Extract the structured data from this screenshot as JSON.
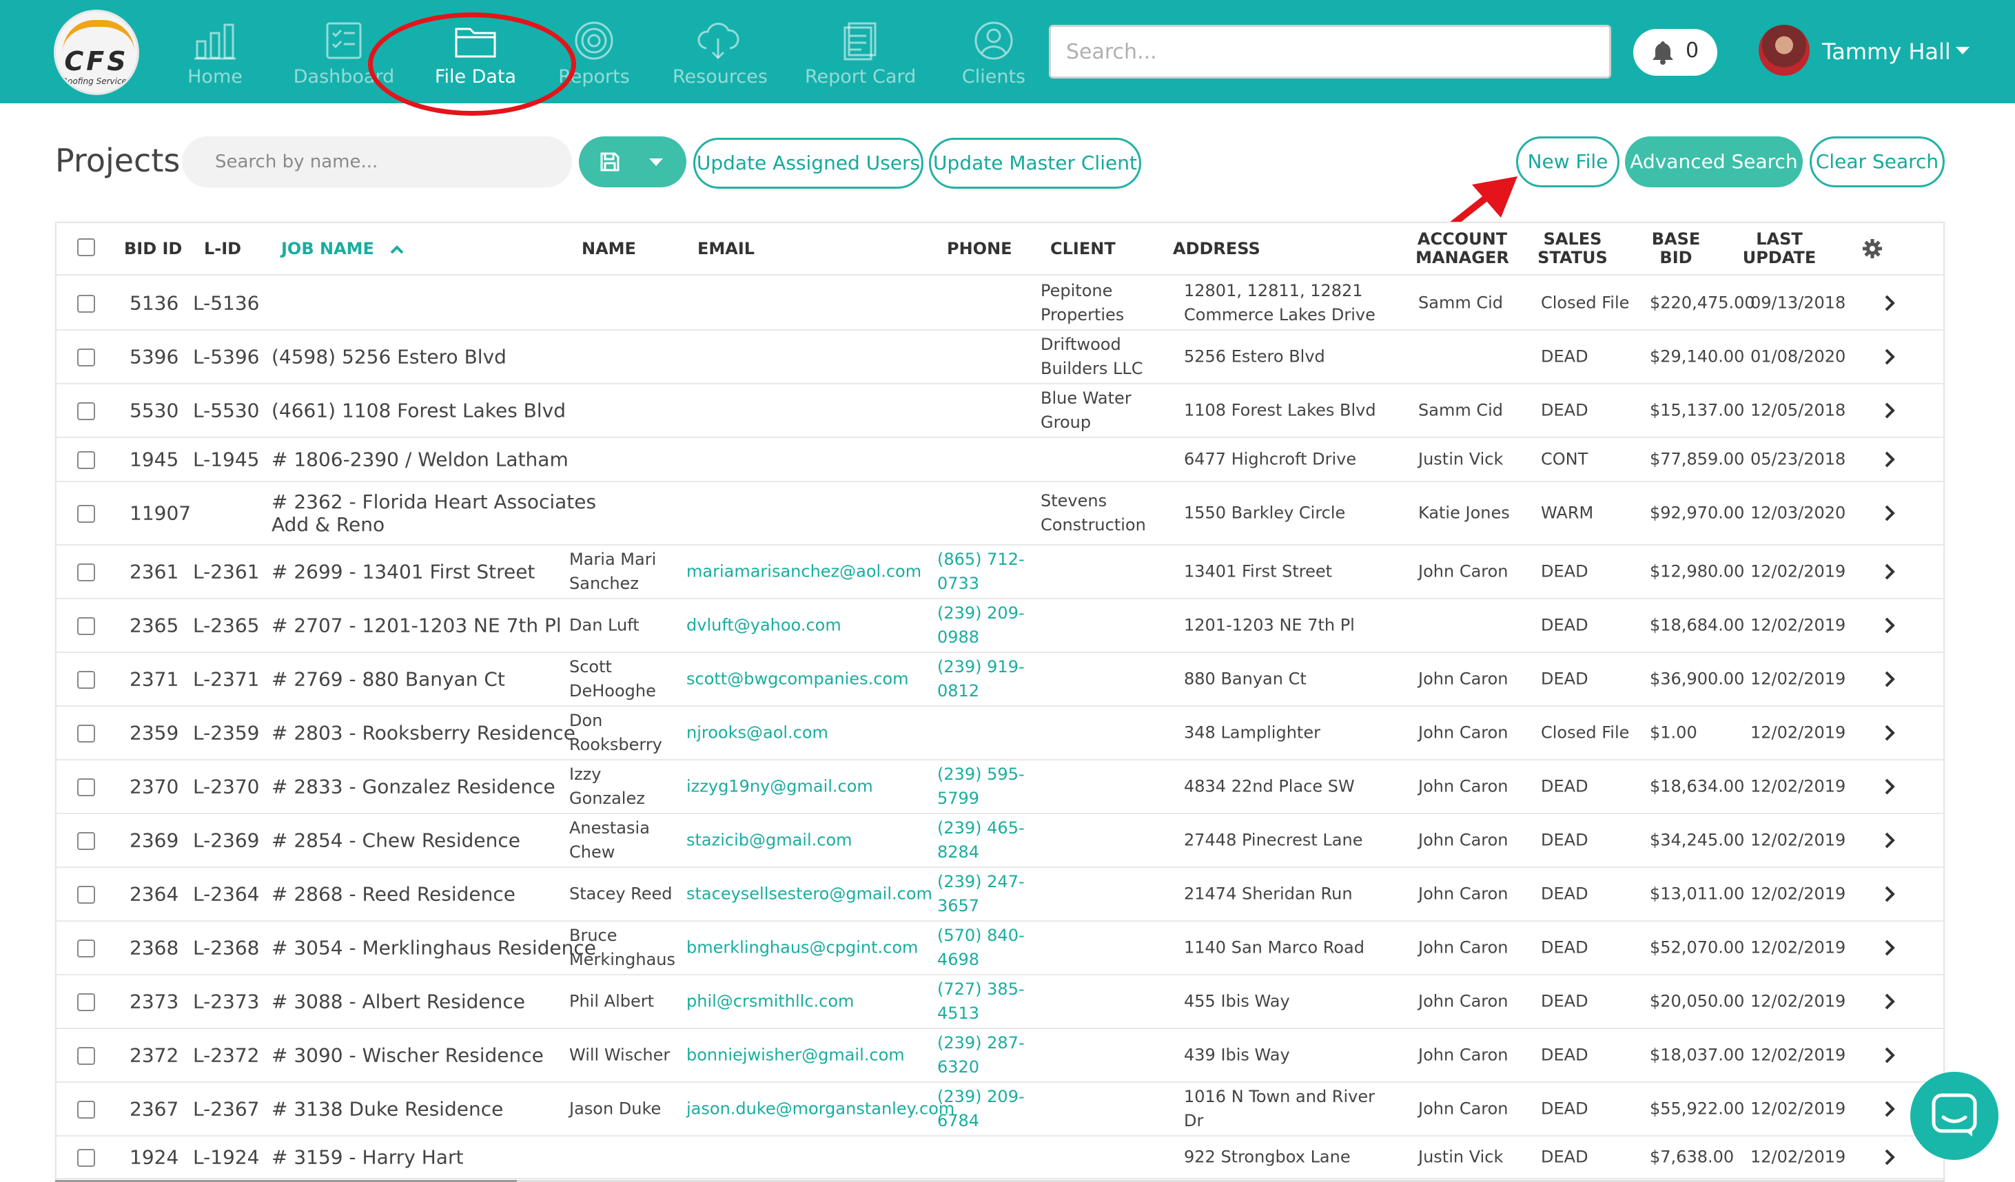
{
  "brand": {
    "logo_letters": "CFS",
    "logo_tagline": "Roofing Services"
  },
  "nav": {
    "items": [
      {
        "label": "Home",
        "icon": "bar-chart-icon"
      },
      {
        "label": "Dashboard",
        "icon": "clipboard-check-icon"
      },
      {
        "label": "File Data",
        "icon": "folder-icon",
        "active": true
      },
      {
        "label": "Reports",
        "icon": "target-icon"
      },
      {
        "label": "Resources",
        "icon": "cloud-download-icon"
      },
      {
        "label": "Report Card",
        "icon": "document-stack-icon"
      },
      {
        "label": "Clients",
        "icon": "user-circle-icon"
      }
    ],
    "search_placeholder": "Search...",
    "notifications_count": "0",
    "user_name": "Tammy Hall"
  },
  "toolbar": {
    "title": "Projects",
    "search_placeholder": "Search by name...",
    "update_users_label": "Update Assigned Users",
    "update_client_label": "Update Master Client",
    "new_file_label": "New File",
    "advanced_search_label": "Advanced Search",
    "clear_search_label": "Clear Search"
  },
  "table": {
    "headers": {
      "bid_id": "BID ID",
      "l_id": "L-ID",
      "job_name": "JOB NAME",
      "name": "NAME",
      "email": "EMAIL",
      "phone": "PHONE",
      "client": "CLIENT",
      "address": "ADDRESS",
      "account_manager_1": "ACCOUNT",
      "account_manager_2": "MANAGER",
      "sales_status_1": "SALES",
      "sales_status_2": "STATUS",
      "base_bid_1": "BASE",
      "base_bid_2": "BID",
      "last_update_1": "LAST",
      "last_update_2": "UPDATE"
    },
    "rows": [
      {
        "bid": "5136",
        "lid": "L-5136",
        "job": "",
        "name": "",
        "email": "",
        "phone": "",
        "client": "Pepitone Properties",
        "address": "12801, 12811, 12821 Commerce Lakes Drive",
        "manager": "Samm Cid",
        "status": "Closed File",
        "base": "$220,475.00",
        "updated": "09/13/2018"
      },
      {
        "bid": "5396",
        "lid": "L-5396",
        "job": "(4598) 5256 Estero Blvd",
        "name": "",
        "email": "",
        "phone": "",
        "client": "Driftwood Builders LLC",
        "address": "5256 Estero Blvd",
        "manager": "",
        "status": "DEAD",
        "base": "$29,140.00",
        "updated": "01/08/2020"
      },
      {
        "bid": "5530",
        "lid": "L-5530",
        "job": "(4661) 1108 Forest Lakes Blvd",
        "name": "",
        "email": "",
        "phone": "",
        "client": "Blue Water Group",
        "address": "1108 Forest Lakes Blvd",
        "manager": "Samm Cid",
        "status": "DEAD",
        "base": "$15,137.00",
        "updated": "12/05/2018"
      },
      {
        "bid": "1945",
        "lid": "L-1945",
        "job": "# 1806-2390 / Weldon Latham",
        "name": "",
        "email": "",
        "phone": "",
        "client": "",
        "address": "6477 Highcroft Drive",
        "manager": "Justin Vick",
        "status": "CONT",
        "base": "$77,859.00",
        "updated": "05/23/2018"
      },
      {
        "bid": "11907",
        "lid": "",
        "job": "# 2362 - Florida Heart Associates Add & Reno",
        "name": "",
        "email": "",
        "phone": "",
        "client": "Stevens Construction",
        "address": "1550 Barkley Circle",
        "manager": "Katie Jones",
        "status": "WARM",
        "base": "$92,970.00",
        "updated": "12/03/2020"
      },
      {
        "bid": "2361",
        "lid": "L-2361",
        "job": "# 2699 - 13401 First Street",
        "name": "Maria Mari Sanchez",
        "email": "mariamarisanchez@aol.com",
        "phone": "(865) 712-0733",
        "client": "",
        "address": "13401 First Street",
        "manager": "John Caron",
        "status": "DEAD",
        "base": "$12,980.00",
        "updated": "12/02/2019"
      },
      {
        "bid": "2365",
        "lid": "L-2365",
        "job": "# 2707 - 1201-1203 NE 7th Pl",
        "name": "Dan Luft",
        "email": "dvluft@yahoo.com",
        "phone": "(239) 209-0988",
        "client": "",
        "address": "1201-1203 NE 7th Pl",
        "manager": "",
        "status": "DEAD",
        "base": "$18,684.00",
        "updated": "12/02/2019"
      },
      {
        "bid": "2371",
        "lid": "L-2371",
        "job": "# 2769 - 880 Banyan Ct",
        "name": "Scott DeHooghe",
        "email": "scott@bwgcompanies.com",
        "phone": "(239) 919-0812",
        "client": "",
        "address": "880 Banyan Ct",
        "manager": "John Caron",
        "status": "DEAD",
        "base": "$36,900.00",
        "updated": "12/02/2019"
      },
      {
        "bid": "2359",
        "lid": "L-2359",
        "job": "# 2803 - Rooksberry Residence",
        "name": "Don Rooksberry",
        "email": "njrooks@aol.com",
        "phone": "",
        "client": "",
        "address": "348 Lamplighter",
        "manager": "John Caron",
        "status": "Closed File",
        "base": "$1.00",
        "updated": "12/02/2019"
      },
      {
        "bid": "2370",
        "lid": "L-2370",
        "job": "# 2833 - Gonzalez Residence",
        "name": "Izzy Gonzalez",
        "email": "izzyg19ny@gmail.com",
        "phone": "(239) 595-5799",
        "client": "",
        "address": "4834 22nd Place SW",
        "manager": "John Caron",
        "status": "DEAD",
        "base": "$18,634.00",
        "updated": "12/02/2019"
      },
      {
        "bid": "2369",
        "lid": "L-2369",
        "job": "# 2854 - Chew Residence",
        "name": "Anestasia Chew",
        "email": "stazicib@gmail.com",
        "phone": "(239) 465-8284",
        "client": "",
        "address": "27448 Pinecrest Lane",
        "manager": "John Caron",
        "status": "DEAD",
        "base": "$34,245.00",
        "updated": "12/02/2019"
      },
      {
        "bid": "2364",
        "lid": "L-2364",
        "job": "# 2868 - Reed Residence",
        "name": "Stacey Reed",
        "email": "staceysellsestero@gmail.com",
        "phone": "(239) 247-3657",
        "client": "",
        "address": "21474 Sheridan Run",
        "manager": "John Caron",
        "status": "DEAD",
        "base": "$13,011.00",
        "updated": "12/02/2019"
      },
      {
        "bid": "2368",
        "lid": "L-2368",
        "job": "# 3054 - Merklinghaus Residence",
        "name": "Bruce Merkinghaus",
        "email": "bmerklinghaus@cpgint.com",
        "phone": "(570) 840-4698",
        "client": "",
        "address": "1140 San Marco Road",
        "manager": "John Caron",
        "status": "DEAD",
        "base": "$52,070.00",
        "updated": "12/02/2019"
      },
      {
        "bid": "2373",
        "lid": "L-2373",
        "job": "# 3088 - Albert Residence",
        "name": "Phil Albert",
        "email": "phil@crsmithllc.com",
        "phone": "(727) 385-4513",
        "client": "",
        "address": "455 Ibis Way",
        "manager": "John Caron",
        "status": "DEAD",
        "base": "$20,050.00",
        "updated": "12/02/2019"
      },
      {
        "bid": "2372",
        "lid": "L-2372",
        "job": "# 3090 - Wischer Residence",
        "name": "Will Wischer",
        "email": "bonniejwisher@gmail.com",
        "phone": "(239) 287-6320",
        "client": "",
        "address": "439 Ibis Way",
        "manager": "John Caron",
        "status": "DEAD",
        "base": "$18,037.00",
        "updated": "12/02/2019"
      },
      {
        "bid": "2367",
        "lid": "L-2367",
        "job": "# 3138 Duke Residence",
        "name": "Jason Duke",
        "email": "jason.duke@morganstanley.com",
        "phone": "(239) 209-6784",
        "client": "",
        "address": "1016 N Town and River Dr",
        "manager": "John Caron",
        "status": "DEAD",
        "base": "$55,922.00",
        "updated": "12/02/2019"
      },
      {
        "bid": "1924",
        "lid": "L-1924",
        "job": "# 3159 - Harry Hart",
        "name": "",
        "email": "",
        "phone": "",
        "client": "",
        "address": "922 Strongbox Lane",
        "manager": "Justin Vick",
        "status": "DEAD",
        "base": "$7,638.00",
        "updated": "12/02/2019"
      }
    ]
  },
  "colors": {
    "nav_bg": "#15b0ab",
    "accent": "#3dbfa9",
    "link": "#19ad9f",
    "annotation": "#e3141a"
  }
}
